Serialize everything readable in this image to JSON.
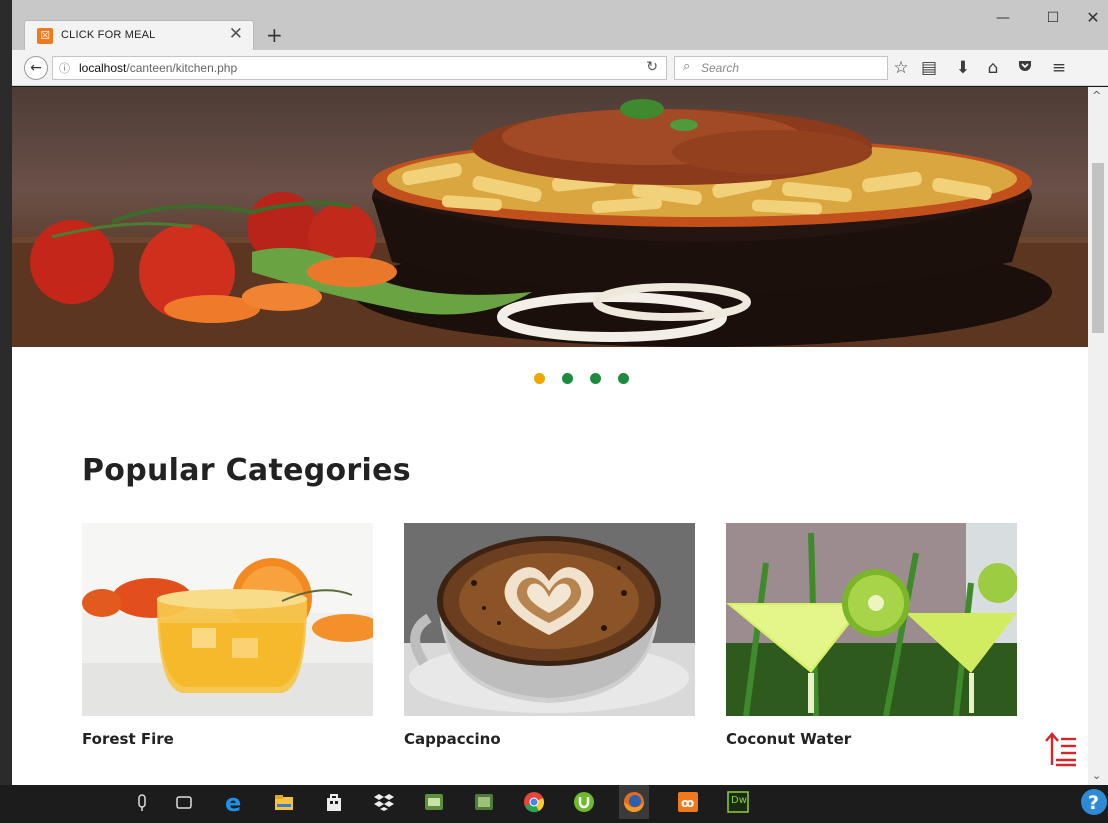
{
  "browser": {
    "tab_title": "CLICK FOR MEAL",
    "tab_close": "✕",
    "new_tab": "+",
    "url_host": "localhost",
    "url_path": "/canteen/kitchen.php",
    "search_placeholder": "Search",
    "window_controls": [
      "minimize",
      "maximize",
      "close"
    ],
    "toolbar_icons": [
      "star-icon",
      "reading-list-icon",
      "download-icon",
      "home-icon",
      "pocket-icon",
      "menu-icon"
    ]
  },
  "hero": {
    "carousel_dots": 4,
    "active_dot": 0,
    "active_color": "#f0a500",
    "inactive_color": "#1d8b3e"
  },
  "categories": {
    "title": "Popular Categories",
    "items": [
      {
        "label": "Forest Fire"
      },
      {
        "label": "Cappaccino"
      },
      {
        "label": "Coconut Water"
      }
    ]
  },
  "taskbar": {
    "apps": [
      "search-icon",
      "task-view-icon",
      "edge-icon",
      "file-explorer-icon",
      "store-icon",
      "dropbox-icon",
      "app-icon",
      "app-icon-2",
      "chrome-icon",
      "utorrent-icon",
      "firefox-icon",
      "xampp-icon",
      "dreamweaver-icon"
    ],
    "dreamweaver_label": "Dw"
  },
  "colors": {
    "accent_red": "#d6262b",
    "xampp_orange": "#f2781e"
  }
}
